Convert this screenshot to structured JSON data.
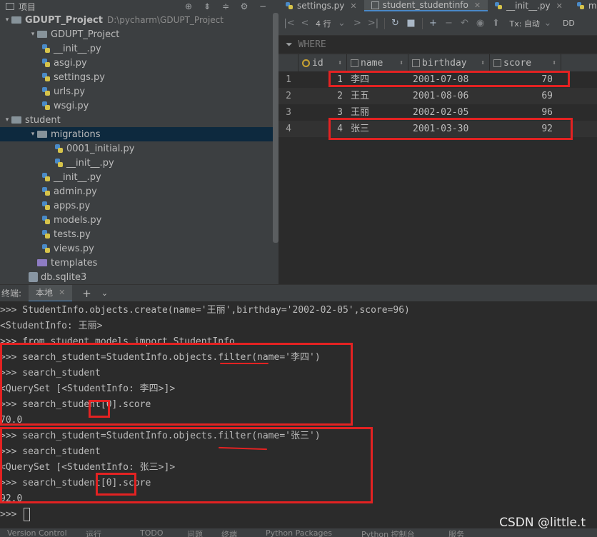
{
  "project": {
    "title": "项目",
    "tree": [
      {
        "label": "GDUPT_Project",
        "path": "D:\\pycharm\\GDUPT_Project",
        "type": "folder",
        "depth": 0,
        "arrow": "▾",
        "bold": true
      },
      {
        "label": "GDUPT_Project",
        "type": "folder",
        "depth": 1,
        "arrow": "▾"
      },
      {
        "label": "__init__.py",
        "type": "py",
        "depth": 2
      },
      {
        "label": "asgi.py",
        "type": "py",
        "depth": 2
      },
      {
        "label": "settings.py",
        "type": "py",
        "depth": 2
      },
      {
        "label": "urls.py",
        "type": "py",
        "depth": 2
      },
      {
        "label": "wsgi.py",
        "type": "py",
        "depth": 2
      },
      {
        "label": "student",
        "type": "folder",
        "depth": 0,
        "arrow": "▾"
      },
      {
        "label": "migrations",
        "type": "folder",
        "depth": 1,
        "arrow": "▾",
        "selected": true
      },
      {
        "label": "0001_initial.py",
        "type": "py",
        "depth": 3
      },
      {
        "label": "__init__.py",
        "type": "py",
        "depth": 3
      },
      {
        "label": "__init__.py",
        "type": "py",
        "depth": 2
      },
      {
        "label": "admin.py",
        "type": "py",
        "depth": 2
      },
      {
        "label": "apps.py",
        "type": "py",
        "depth": 2
      },
      {
        "label": "models.py",
        "type": "py",
        "depth": 2
      },
      {
        "label": "tests.py",
        "type": "py",
        "depth": 2
      },
      {
        "label": "views.py",
        "type": "py",
        "depth": 2
      },
      {
        "label": "templates",
        "type": "folder-purple",
        "depth": 1
      },
      {
        "label": "db.sqlite3",
        "type": "db",
        "depth": 1
      }
    ]
  },
  "tabs": [
    {
      "label": "settings.py",
      "icon": "python-file-icon",
      "active": false
    },
    {
      "label": "student_studentinfo",
      "icon": "table-icon",
      "active": true
    },
    {
      "label": "__init__.py",
      "icon": "python-file-icon",
      "active": false
    },
    {
      "label": "models",
      "icon": "python-file-icon",
      "active": false
    }
  ],
  "db_toolbar": {
    "rows_label": "4 行",
    "tx_label": "Tx: 自动",
    "extra_label": "DD"
  },
  "where_label": "WHERE",
  "table": {
    "columns": [
      "id",
      "name",
      "birthday",
      "score"
    ],
    "rows": [
      {
        "n": "1",
        "id": "1",
        "name": "李四",
        "birthday": "2001-07-08",
        "score": "70"
      },
      {
        "n": "2",
        "id": "2",
        "name": "王五",
        "birthday": "2001-08-06",
        "score": "69"
      },
      {
        "n": "3",
        "id": "3",
        "name": "王丽",
        "birthday": "2002-02-05",
        "score": "96"
      },
      {
        "n": "4",
        "id": "4",
        "name": "张三",
        "birthday": "2001-03-30",
        "score": "92"
      }
    ]
  },
  "terminal": {
    "title": "终端:",
    "tab_label": "本地",
    "lines": [
      ">>> StudentInfo.objects.create(name='王丽',birthday='2002-02-05',score=96)",
      "<StudentInfo: 王丽>",
      ">>> from student.models import StudentInfo",
      ">>> search_student=StudentInfo.objects.filter(name='李四')",
      ">>> search_student",
      "<QuerySet [<StudentInfo: 李四>]>",
      ">>> search_student[0].score",
      "70.0",
      ">>> search_student=StudentInfo.objects.filter(name='张三')",
      ">>> search_student",
      "<QuerySet [<StudentInfo: 张三>]>",
      ">>> search_student[0].score",
      "92.0",
      ">>> "
    ]
  },
  "bottom_bar": {
    "items": [
      "Version Control",
      "运行",
      "TODO",
      "问题",
      "终端",
      "Python Packages",
      "Python 控制台",
      "服务"
    ]
  },
  "watermark": "CSDN @little.t",
  "colors": {
    "annotation_red": "#e32222",
    "selection_blue": "#0d293e",
    "accent_blue": "#4a88c7"
  }
}
